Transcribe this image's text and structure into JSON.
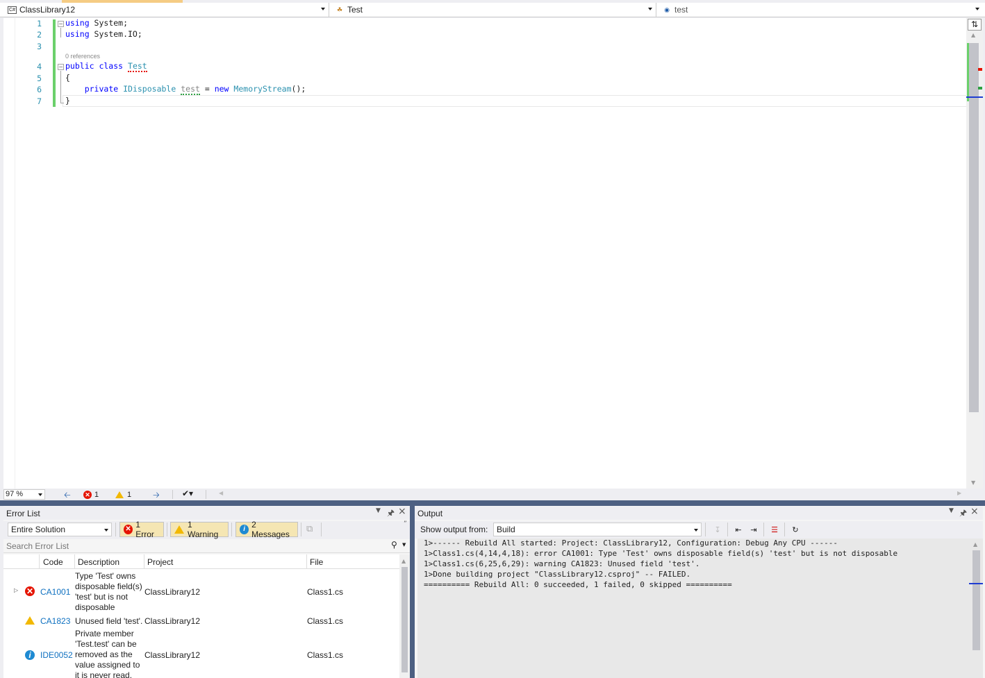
{
  "nav": {
    "project": "ClassLibrary12",
    "type": "Test",
    "member": "test"
  },
  "editor": {
    "line_numbers": [
      "1",
      "2",
      "3",
      "4",
      "5",
      "6",
      "7"
    ],
    "references": "0 references",
    "zoom": "97 %",
    "error_count": "1",
    "warning_count": "1"
  },
  "error_list": {
    "title": "Error List",
    "scope": "Entire Solution",
    "errors_btn": "1 Error",
    "warnings_btn": "1 Warning",
    "messages_btn": "2 Messages",
    "search_placeholder": "Search Error List",
    "columns": [
      "Code",
      "Description",
      "Project",
      "File"
    ],
    "rows": [
      {
        "code": "CA1001",
        "description": "Type 'Test' owns disposable field(s) 'test' but is not disposable",
        "project": "ClassLibrary12",
        "file": "Class1.cs"
      },
      {
        "code": "CA1823",
        "description": "Unused field 'test'.",
        "project": "ClassLibrary12",
        "file": "Class1.cs"
      },
      {
        "code": "IDE0052",
        "description": "Private member 'Test.test' can be removed as the value assigned to it is never read.",
        "project": "ClassLibrary12",
        "file": "Class1.cs"
      }
    ]
  },
  "output": {
    "title": "Output",
    "show_from_label": "Show output from:",
    "source": "Build",
    "lines": [
      "1>------ Rebuild All started: Project: ClassLibrary12, Configuration: Debug Any CPU ------",
      "1>Class1.cs(4,14,4,18): error CA1001: Type 'Test' owns disposable field(s) 'test' but is not disposable",
      "1>Class1.cs(6,25,6,29): warning CA1823: Unused field 'test'.",
      "1>Done building project \"ClassLibrary12.csproj\" -- FAILED.",
      "========== Rebuild All: 0 succeeded, 1 failed, 0 skipped =========="
    ]
  }
}
